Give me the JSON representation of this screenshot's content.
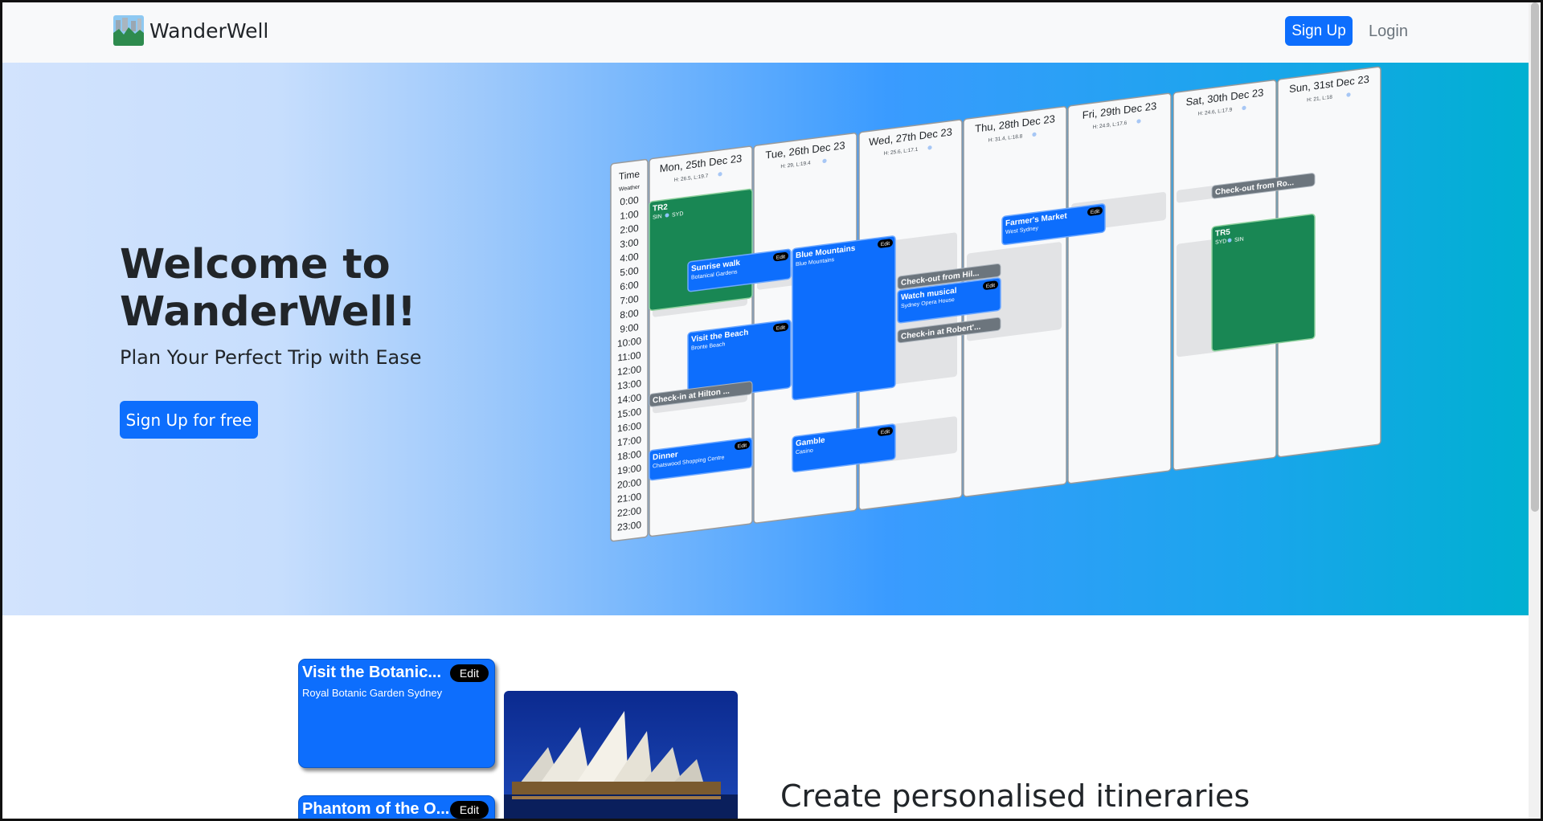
{
  "navbar": {
    "brand_name": "WanderWell",
    "signup_label": "Sign Up",
    "login_label": "Login"
  },
  "hero": {
    "title_line1": "Welcome to",
    "title_line2": "WanderWell!",
    "subtitle": "Plan Your Perfect Trip with Ease",
    "cta_label": "Sign Up for free"
  },
  "calendar_preview": {
    "time_header": "Time",
    "weather_header": "Weather",
    "hours": [
      "0:00",
      "1:00",
      "2:00",
      "3:00",
      "4:00",
      "5:00",
      "6:00",
      "7:00",
      "8:00",
      "9:00",
      "10:00",
      "11:00",
      "12:00",
      "13:00",
      "14:00",
      "15:00",
      "16:00",
      "17:00",
      "18:00",
      "19:00",
      "20:00",
      "21:00",
      "22:00",
      "23:00"
    ],
    "days": [
      {
        "label": "Mon, 25th Dec 23",
        "weather": "H: 26.5, L:19.7"
      },
      {
        "label": "Tue, 26th Dec 23",
        "weather": "H: 29, L:19.4"
      },
      {
        "label": "Wed, 27th Dec 23",
        "weather": "H: 25.6, L:17.1"
      },
      {
        "label": "Thu, 28th Dec 23",
        "weather": "H: 31.4, L:18.8"
      },
      {
        "label": "Fri, 29th Dec 23",
        "weather": "H: 24.9, L:17.6"
      },
      {
        "label": "Sat, 30th Dec 23",
        "weather": "H: 24.6, L:17.9"
      },
      {
        "label": "Sun, 31st Dec 23",
        "weather": "H: 21, L:18"
      }
    ],
    "events": {
      "tr2": {
        "title": "TR2",
        "from": "SIN",
        "to": "SYD"
      },
      "sunrise": {
        "title": "Sunrise walk",
        "sub": "Botanical Gardens"
      },
      "beach": {
        "title": "Visit the Beach",
        "sub": "Bronte Beach"
      },
      "checkin_hilton": {
        "title": "Check-in at Hilton ..."
      },
      "dinner": {
        "title": "Dinner",
        "sub": "Chatswood Shopping Centre"
      },
      "blue_mountains": {
        "title": "Blue Mountains",
        "sub": "Blue Mountains"
      },
      "gamble": {
        "title": "Gamble",
        "sub": "Casino"
      },
      "checkout_hil": {
        "title": "Check-out from Hil..."
      },
      "musical": {
        "title": "Watch musical",
        "sub": "Sydney Opera House"
      },
      "checkin_robert": {
        "title": "Check-in at Robert'..."
      },
      "farmers": {
        "title": "Farmer's Market",
        "sub": "West Sydney"
      },
      "checkout_ro": {
        "title": "Check-out from Ro..."
      },
      "tr5": {
        "title": "TR5",
        "from": "SYD",
        "to": "SIN"
      }
    },
    "edit_label": "Edit"
  },
  "features": {
    "card1": {
      "title": "Visit the Botanic...",
      "sub": "Royal Botanic Garden Sydney",
      "edit": "Edit"
    },
    "card2": {
      "title": "Phantom of the O...",
      "edit": "Edit"
    },
    "heading": "Create personalised itineraries"
  }
}
